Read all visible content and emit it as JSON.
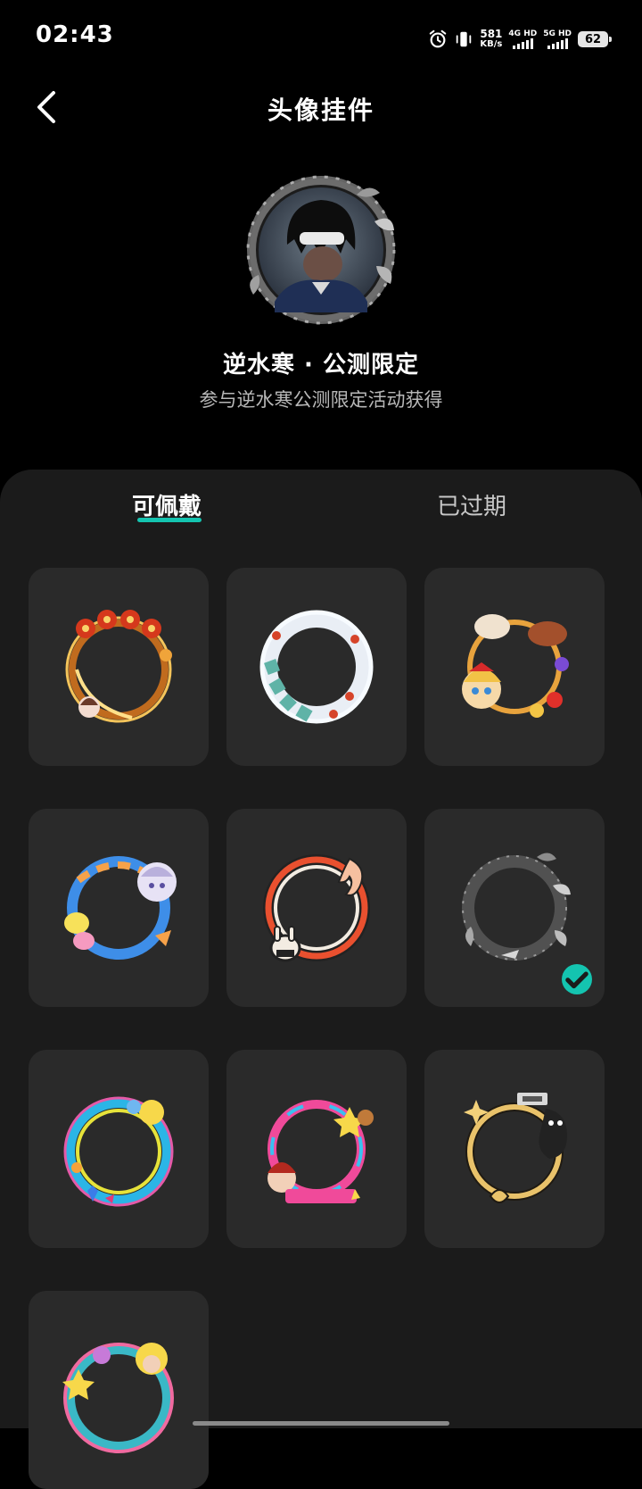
{
  "status_bar": {
    "time": "02:43",
    "net_speed_value": "581",
    "net_speed_unit": "KB/s",
    "sim1_label": "4G HD",
    "sim2_label": "5G HD",
    "battery": "62",
    "icons": [
      "alarm-icon",
      "vibrate-icon"
    ]
  },
  "header": {
    "title": "头像挂件",
    "back_icon": "chevron-left-icon"
  },
  "preview": {
    "name": "逆水寒 · 公测限定",
    "description": "参与逆水寒公测限定活动获得"
  },
  "tabs": [
    {
      "label": "可佩戴",
      "active": true
    },
    {
      "label": "已过期",
      "active": false
    }
  ],
  "pendants": [
    {
      "id": "frame-new-year-lantern",
      "selected": false
    },
    {
      "id": "frame-snow-cloud",
      "selected": false
    },
    {
      "id": "frame-doll-horse",
      "selected": false
    },
    {
      "id": "frame-blue-ribbon-anime",
      "selected": false
    },
    {
      "id": "frame-zero-red-flame",
      "selected": false
    },
    {
      "id": "frame-ink-wash-silver",
      "selected": true
    },
    {
      "id": "frame-rainbow-neon",
      "selected": false
    },
    {
      "id": "frame-pink-star-girl",
      "selected": false
    },
    {
      "id": "frame-gold-sale-cat",
      "selected": false
    },
    {
      "id": "frame-cartoon-party",
      "selected": false
    }
  ],
  "colors": {
    "accent": "#14c4b0",
    "sheet_bg": "#1b1b1b",
    "card_bg": "#2a2a2a"
  }
}
